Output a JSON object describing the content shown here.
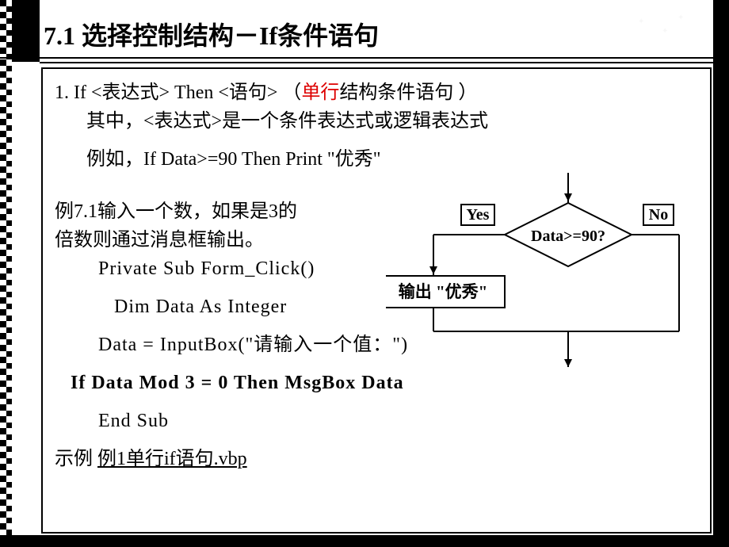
{
  "header": {
    "title": "7.1 选择控制结构－If条件语句"
  },
  "body": {
    "line1a": "1.  If <表达式> Then <语句> （",
    "line1b": "单行",
    "line1c": "结构条件语句 ）",
    "line2": "其中，<表达式>是一个条件表达式或逻辑表达式",
    "line3": "例如，If   Data>=90   Then Print  \"优秀\"",
    "line4": "例7.1输入一个数，如果是3的",
    "line5": "倍数则通过消息框输出。",
    "code1": "Private Sub Form_Click()",
    "code2": "Dim Data As Integer",
    "code3": "Data = InputBox(\"请输入一个值：\")",
    "code4": "If   Data Mod 3 = 0 Then MsgBox Data",
    "code5": "End Sub",
    "example_prefix": "示例 ",
    "example_link": "例1单行if语句.vbp"
  },
  "flow": {
    "yes": "Yes",
    "no": "No",
    "cond": "Data>=90?",
    "out": "输出 \"优秀\""
  }
}
